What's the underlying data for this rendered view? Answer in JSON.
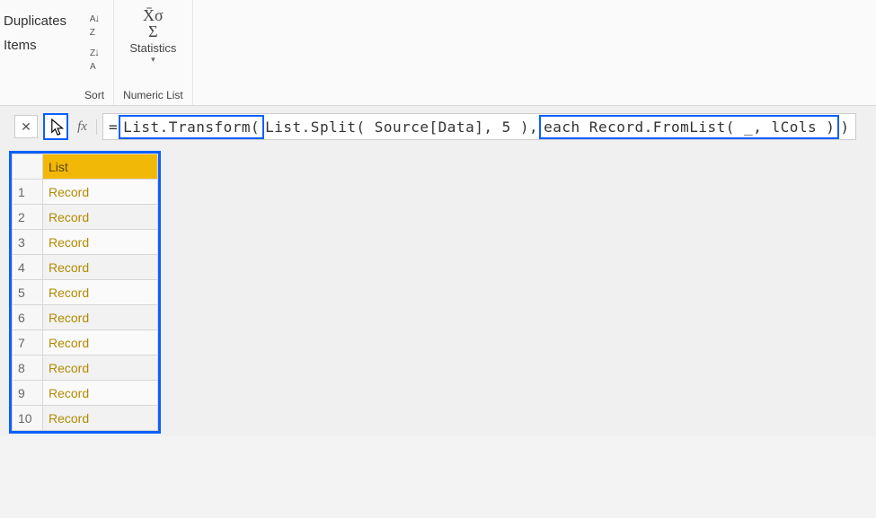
{
  "ribbon": {
    "remove_group": {
      "line1": "Duplicates",
      "line2": "Items"
    },
    "sort_group": {
      "az_icon": "A↕Z",
      "za_icon": "Z↕A",
      "label": "Sort"
    },
    "stats_group": {
      "sigma_top": "X̄σ",
      "sigma_bottom": "Σ",
      "button_label": "Statistics",
      "group_label": "Numeric List"
    }
  },
  "formula_bar": {
    "cancel": "✕",
    "confirm": "✓",
    "fx": "fx",
    "prefix": "= ",
    "seg1": "List.Transform( ",
    "seg2": "List.Split( Source[Data], 5 )",
    "seg_comma": ", ",
    "seg3": "each Record.FromList( _, lCols )",
    "suffix": ")"
  },
  "list": {
    "header": "List",
    "rows": [
      {
        "n": "1",
        "v": "Record"
      },
      {
        "n": "2",
        "v": "Record"
      },
      {
        "n": "3",
        "v": "Record"
      },
      {
        "n": "4",
        "v": "Record"
      },
      {
        "n": "5",
        "v": "Record"
      },
      {
        "n": "6",
        "v": "Record"
      },
      {
        "n": "7",
        "v": "Record"
      },
      {
        "n": "8",
        "v": "Record"
      },
      {
        "n": "9",
        "v": "Record"
      },
      {
        "n": "10",
        "v": "Record"
      }
    ]
  }
}
